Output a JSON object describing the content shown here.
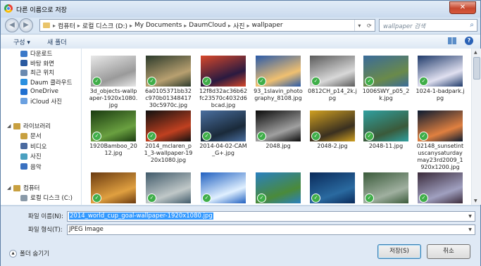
{
  "window": {
    "title": "다른 이름으로 저장",
    "close_label": "✕"
  },
  "address_bar": {
    "crumbs": [
      "컴퓨터",
      "로컬 디스크 (D:)",
      "My Documents",
      "DaumCloud",
      "사진",
      "wallpaper"
    ],
    "refresh_icon": "refresh-icon"
  },
  "search": {
    "placeholder": "wallpaper 검색"
  },
  "toolbar": {
    "organize": "구성 ▾",
    "new_folder": "새 폴더"
  },
  "sidebar": {
    "favorites": [
      {
        "label": "다운로드",
        "icon": "download-folder-icon"
      },
      {
        "label": "바탕 화면",
        "icon": "desktop-icon"
      },
      {
        "label": "최근 위치",
        "icon": "recent-places-icon"
      },
      {
        "label": "Daum 클라우드",
        "icon": "daum-cloud-icon"
      },
      {
        "label": "OneDrive",
        "icon": "onedrive-icon"
      },
      {
        "label": "iCloud 사진",
        "icon": "icloud-icon"
      }
    ],
    "libraries_header": "라이브러리",
    "libraries": [
      {
        "label": "문서",
        "icon": "documents-icon"
      },
      {
        "label": "비디오",
        "icon": "videos-icon"
      },
      {
        "label": "사진",
        "icon": "pictures-icon"
      },
      {
        "label": "음악",
        "icon": "music-icon"
      }
    ],
    "computer_header": "컴퓨터",
    "computer": [
      {
        "label": "로컬 디스크 (C:)",
        "icon": "local-disk-icon"
      }
    ]
  },
  "files": [
    {
      "name": "3d_objects-wallpaper-1920x1080.jpg",
      "colors": [
        "#e8e8e8",
        "#9a9a9a"
      ]
    },
    {
      "name": "6a0105371bb32c970b0134841730c5970c.jpg",
      "colors": [
        "#2b3a2b",
        "#b8a070"
      ]
    },
    {
      "name": "12f8d32ac36b62fc23570c4032d6bcad.jpg",
      "colors": [
        "#d8482a",
        "#2a1a40"
      ]
    },
    {
      "name": "93_1slavin_photography_8108.jpg",
      "colors": [
        "#2a5aa8",
        "#f0c070"
      ]
    },
    {
      "name": "0812CH_p14_2k.jpg",
      "colors": [
        "#5a5a5a",
        "#d8d8d8"
      ]
    },
    {
      "name": "1006SWY_p05_2k.jpg",
      "colors": [
        "#3a6b9a",
        "#6a8a4a"
      ]
    },
    {
      "name": "1024-1-badpark.jpg",
      "colors": [
        "#1f3a6a",
        "#e0e0f0"
      ]
    },
    {
      "name": "1920Bamboo_2012.jpg",
      "colors": [
        "#1a3a10",
        "#6aa040"
      ]
    },
    {
      "name": "2014_mclaren_p1_3-wallpaper-1920x1080.jpg",
      "colors": [
        "#101010",
        "#c04020"
      ]
    },
    {
      "name": "2014-04-02-CAM_G+.jpg",
      "colors": [
        "#4a6fa0",
        "#1a2a3a"
      ]
    },
    {
      "name": "2048.jpg",
      "colors": [
        "#0a0a0a",
        "#a0a0a0"
      ]
    },
    {
      "name": "2048-2.jpg",
      "colors": [
        "#d0a020",
        "#3a3020"
      ]
    },
    {
      "name": "2048-11.jpg",
      "colors": [
        "#30a0a0",
        "#3a5a3a"
      ]
    },
    {
      "name": "02148_sunsetintuscanysaturdaymay23rd2009_1920x1200.jpg",
      "colors": [
        "#0a1a30",
        "#e08040"
      ]
    },
    {
      "name": "",
      "colors": [
        "#6a3a10",
        "#e0a040"
      ]
    },
    {
      "name": "",
      "colors": [
        "#405a6a",
        "#c0c8c8"
      ]
    },
    {
      "name": "",
      "colors": [
        "#2060c0",
        "#e0f0ff"
      ]
    },
    {
      "name": "",
      "colors": [
        "#2a80c0",
        "#4a8a3a"
      ]
    },
    {
      "name": "",
      "colors": [
        "#0a2a5a",
        "#2a6aa0"
      ]
    },
    {
      "name": "",
      "colors": [
        "#3a5a3a",
        "#a0b0a0"
      ]
    },
    {
      "name": "",
      "colors": [
        "#3a2a3a",
        "#a0a0c0"
      ]
    }
  ],
  "bottom": {
    "filename_label": "파일 이름(N):",
    "filename_value": "2014_world_cup_goal-wallpaper-1920x1080.jpg",
    "filetype_label": "파일 형식(T):",
    "filetype_value": "JPEG Image",
    "hide_folders": "폴더 숨기기",
    "save_button": "저장(S)",
    "cancel_button": "취소"
  }
}
